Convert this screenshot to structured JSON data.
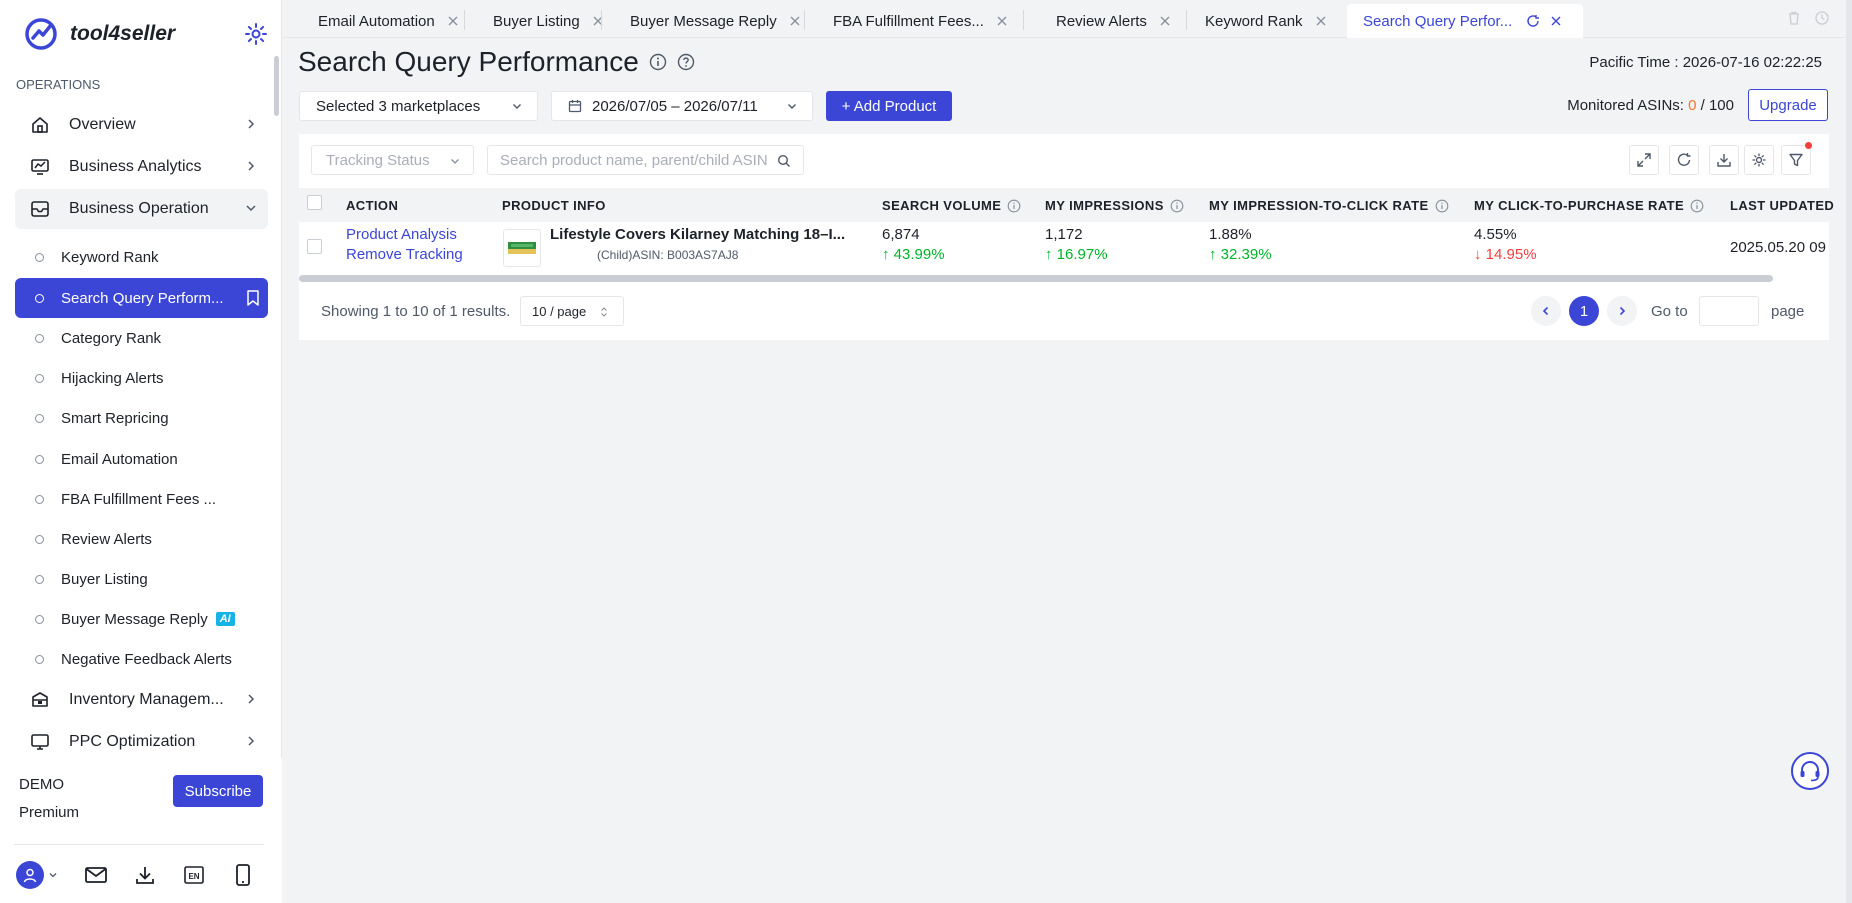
{
  "brand": {
    "name": "tool4seller",
    "accent": "#3b46d6"
  },
  "sidebar": {
    "section_label": "OPERATIONS",
    "top_items": [
      {
        "label": "Overview",
        "icon": "home-icon"
      },
      {
        "label": "Business Analytics",
        "icon": "chart-monitor-icon"
      },
      {
        "label": "Business Operation",
        "icon": "inbox-icon"
      }
    ],
    "sub_items": [
      {
        "label": "Keyword Rank"
      },
      {
        "label": "Search Query Perform..."
      },
      {
        "label": "Category Rank"
      },
      {
        "label": "Hijacking Alerts"
      },
      {
        "label": "Smart Repricing"
      },
      {
        "label": "Email Automation"
      },
      {
        "label": "FBA Fulfillment Fees ..."
      },
      {
        "label": "Review Alerts"
      },
      {
        "label": "Buyer Listing"
      },
      {
        "label": "Buyer Message Reply",
        "badge": "AI"
      },
      {
        "label": "Negative Feedback Alerts"
      }
    ],
    "bottom_items": [
      {
        "label": "Inventory Managem...",
        "icon": "box-icon"
      },
      {
        "label": "PPC Optimization",
        "icon": "monitor-icon"
      }
    ],
    "account": {
      "name": "DEMO",
      "plan": "Premium",
      "subscribe_label": "Subscribe"
    }
  },
  "tabs": [
    {
      "label": "Email Automation"
    },
    {
      "label": "Buyer Listing"
    },
    {
      "label": "Buyer Message Reply"
    },
    {
      "label": "FBA Fulfillment Fees..."
    },
    {
      "label": "Review Alerts"
    },
    {
      "label": "Keyword Rank"
    },
    {
      "label": "Search Query Perfor...",
      "active": true
    }
  ],
  "page": {
    "title": "Search Query Performance",
    "pacific_time": "Pacific Time :  2026-07-16 02:22:25",
    "marketplaces": "Selected 3 marketplaces",
    "date_range": "2026/07/05 – 2026/07/11",
    "add_product": "+ Add Product",
    "monitored_label": "Monitored ASINs:",
    "monitored_used": "0",
    "monitored_total": "/  100",
    "upgrade": "Upgrade"
  },
  "filters": {
    "tracking_status_placeholder": "Tracking Status",
    "search_placeholder": "Search product name, parent/child ASIN"
  },
  "table": {
    "headers": {
      "action": "ACTION",
      "product_info": "PRODUCT INFO",
      "search_volume": "SEARCH VOLUME",
      "impressions": "MY IMPRESSIONS",
      "ctr": "MY IMPRESSION-TO-CLICK RATE",
      "cvr": "MY CLICK-TO-PURCHASE RATE",
      "last_updated": "LAST UPDATED"
    },
    "rows": [
      {
        "action_1": "Product Analysis",
        "action_2": "Remove Tracking",
        "product_name": "Lifestyle Covers Kilarney Matching 18–I...",
        "asin": "(Child)ASIN: B003AS7AJ8",
        "search_volume": "6,874",
        "search_volume_change": "↑ 43.99%",
        "impressions": "1,172",
        "impressions_change": "↑ 16.97%",
        "ctr": "1.88%",
        "ctr_change": "↑ 32.39%",
        "cvr": "4.55%",
        "cvr_change": "↓ 14.95%",
        "last_updated": "2025.05.20 09"
      }
    ]
  },
  "pagination": {
    "showing": "Showing 1 to 10 of 1 results.",
    "page_size": "10 / page",
    "current_page": "1",
    "goto_label": "Go to",
    "page_label": "page"
  }
}
